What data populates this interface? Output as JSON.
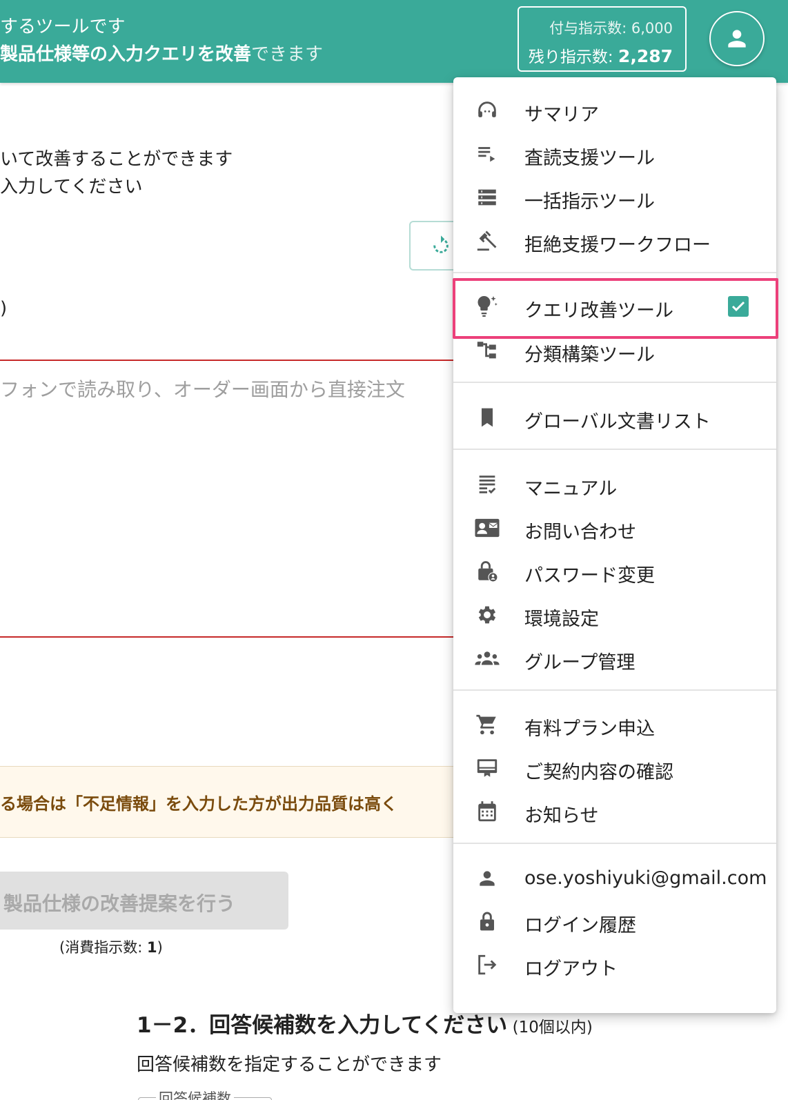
{
  "header": {
    "line1": "するツールです",
    "line2_bold": "製品仕様等の入力クエリを改善",
    "line2_rest": "できます",
    "granted_label": "付与指示数: 6,000",
    "remaining_label": "残り指示数: ",
    "remaining_value": "2,287"
  },
  "page": {
    "desc1": "いて改善することができます",
    "desc2": "入力してください",
    "paren": ")",
    "input_placeholder": "フォンで読み取り、オーダー画面から直接注文",
    "warning": "る場合は「不足情報」を入力した方が出力品質は高く",
    "submit_label": "製品仕様の改善提案を行う",
    "consume_prefix": "(消費指示数: ",
    "consume_value": "1",
    "consume_suffix": ")",
    "section_title": "1－2．回答候補数を入力してください",
    "section_note": " (10個以内)",
    "section_sub": "回答候補数を指定することができます",
    "field_label": "回答候補数"
  },
  "menu": {
    "items": [
      {
        "label": "サマリア",
        "icon": "headset-icon"
      },
      {
        "label": "査読支援ツール",
        "icon": "playlist-play-icon"
      },
      {
        "label": "一括指示ツール",
        "icon": "list-icon"
      },
      {
        "label": "拒絶支援ワークフロー",
        "icon": "gavel-icon"
      },
      {
        "label": "クエリ改善ツール",
        "icon": "lightbulb-sparkle-icon",
        "checked": true
      },
      {
        "label": "分類構築ツール",
        "icon": "tree-icon"
      },
      {
        "label": "グローバル文書リスト",
        "icon": "bookmark-icon"
      },
      {
        "label": "マニュアル",
        "icon": "checklist-icon"
      },
      {
        "label": "お問い合わせ",
        "icon": "contact-mail-icon"
      },
      {
        "label": "パスワード変更",
        "icon": "lock-person-icon"
      },
      {
        "label": "環境設定",
        "icon": "gear-icon"
      },
      {
        "label": "グループ管理",
        "icon": "groups-icon"
      },
      {
        "label": "有料プラン申込",
        "icon": "cart-icon"
      },
      {
        "label": "ご契約内容の確認",
        "icon": "contract-icon"
      },
      {
        "label": "お知らせ",
        "icon": "calendar-icon"
      },
      {
        "label": "ose.yoshiyuki@gmail.com",
        "icon": "person-icon"
      },
      {
        "label": "ログイン履歴",
        "icon": "lock-icon"
      },
      {
        "label": "ログアウト",
        "icon": "logout-icon"
      }
    ]
  },
  "colors": {
    "accent": "#3aaa99",
    "highlight": "#ec407a",
    "error_line": "#c62828"
  }
}
